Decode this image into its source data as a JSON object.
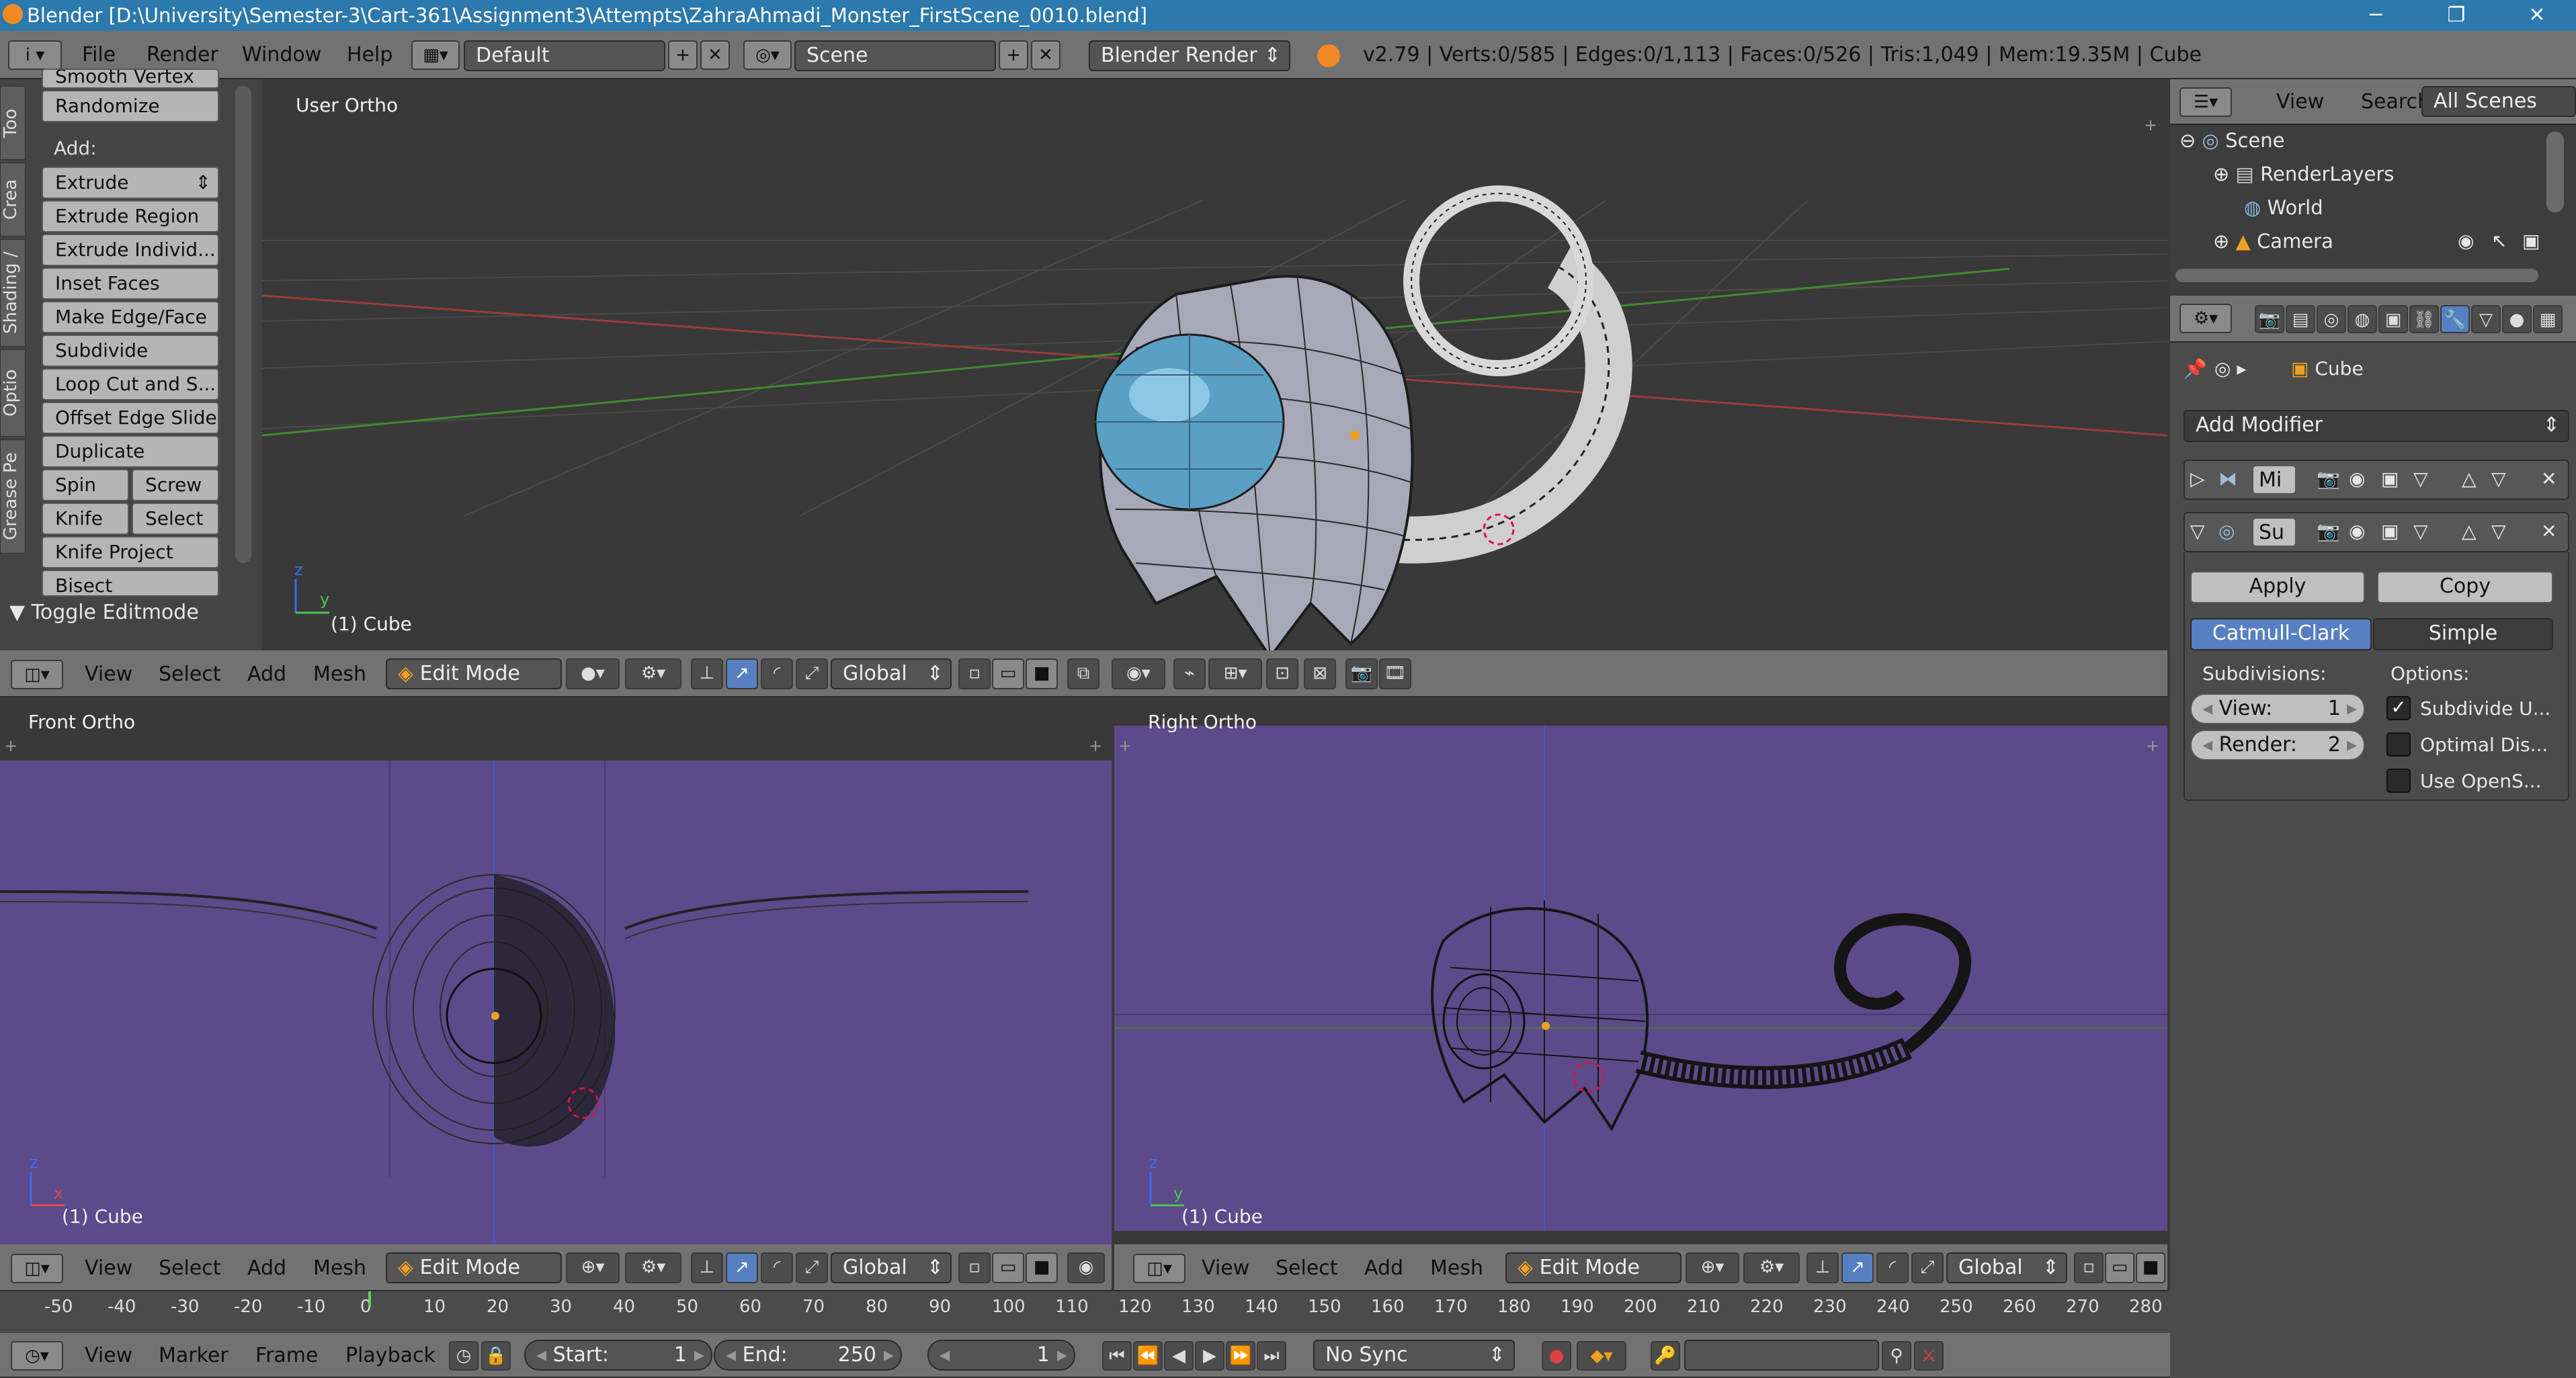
{
  "window": {
    "title": "Blender [D:\\University\\Semester-3\\Cart-361\\Assignment3\\Attempts\\ZahraAhmadi_Monster_FirstScene_0010.blend]",
    "minimize": "─",
    "maximize": "❐",
    "close": "✕"
  },
  "topbar": {
    "info_icon": "i",
    "menus": [
      "File",
      "Render",
      "Window",
      "Help"
    ],
    "layout": "Default",
    "scene": "Scene",
    "engine": "Blender Render",
    "stats": "v2.79 | Verts:0/585 | Edges:0/1,113 | Faces:0/526 | Tris:1,049 | Mem:19.35M | Cube"
  },
  "toolshelf": {
    "tabs": [
      "Too",
      "Crea",
      "Shading /",
      "Optio",
      "Grease Pe"
    ],
    "partial_top": "Smooth Vertex",
    "randomize": "Randomize",
    "add_label": "Add:",
    "extrude": "Extrude",
    "items": [
      "Extrude Region",
      "Extrude Individ...",
      "Inset Faces",
      "Make Edge/Face",
      "Subdivide",
      "Loop Cut and S...",
      "Offset Edge Slide",
      "Duplicate"
    ],
    "spin": "Spin",
    "screw": "Screw",
    "knife": "Knife",
    "select": "Select",
    "knife_project": "Knife Project",
    "bisect": "Bisect",
    "toggle_editmode": "Toggle Editmode"
  },
  "viewport_top": {
    "label": "User Ortho",
    "object": "(1) Cube",
    "axis_z": "z",
    "axis_y": "y"
  },
  "viewport_front": {
    "label": "Front Ortho",
    "object": "(1) Cube",
    "axis_z": "z",
    "axis_x": "x"
  },
  "viewport_right": {
    "label": "Right Ortho",
    "object": "(1) Cube",
    "axis_z": "z",
    "axis_y": "y"
  },
  "view3d_header": {
    "menus": [
      "View",
      "Select",
      "Add",
      "Mesh"
    ],
    "mode": "Edit Mode",
    "orientation": "Global"
  },
  "outliner": {
    "menus": [
      "View",
      "Search"
    ],
    "scope": "All Scenes",
    "items": [
      "Scene",
      "RenderLayers",
      "World",
      "Camera"
    ]
  },
  "properties": {
    "breadcrumb": "Cube",
    "add_modifier": "Add Modifier",
    "mod1_name": "Mi",
    "mod2_name": "Su",
    "apply": "Apply",
    "copy": "Copy",
    "catmull": "Catmull-Clark",
    "simple": "Simple",
    "subdivisions_label": "Subdivisions:",
    "options_label": "Options:",
    "view_label": "View:",
    "view_value": "1",
    "render_label": "Render:",
    "render_value": "2",
    "opt1": "Subdivide U...",
    "opt2": "Optimal Dis...",
    "opt3": "Use OpenS...",
    "opt1_checked": true,
    "opt2_checked": false,
    "opt3_checked": false
  },
  "timeline": {
    "ticks": [
      "-50",
      "-40",
      "-30",
      "-20",
      "-10",
      "0",
      "10",
      "20",
      "30",
      "40",
      "50",
      "60",
      "70",
      "80",
      "90",
      "100",
      "110",
      "120",
      "130",
      "140",
      "150",
      "160",
      "170",
      "180",
      "190",
      "200",
      "210",
      "220",
      "230",
      "240",
      "250",
      "260",
      "270",
      "280"
    ],
    "current_frame": 1,
    "menus": [
      "View",
      "Marker",
      "Frame",
      "Playback"
    ],
    "start_label": "Start:",
    "start_value": "1",
    "end_label": "End:",
    "end_value": "250",
    "current_value": "1",
    "sync": "No Sync"
  },
  "colors": {
    "titlebar": "#2b79ad",
    "viewport_bg": "#393939",
    "ortho_bg": "#5c4a8a",
    "accent_blue": "#5680c2",
    "grid_red": "#9a3b3b",
    "grid_green": "#3f8a2e"
  }
}
